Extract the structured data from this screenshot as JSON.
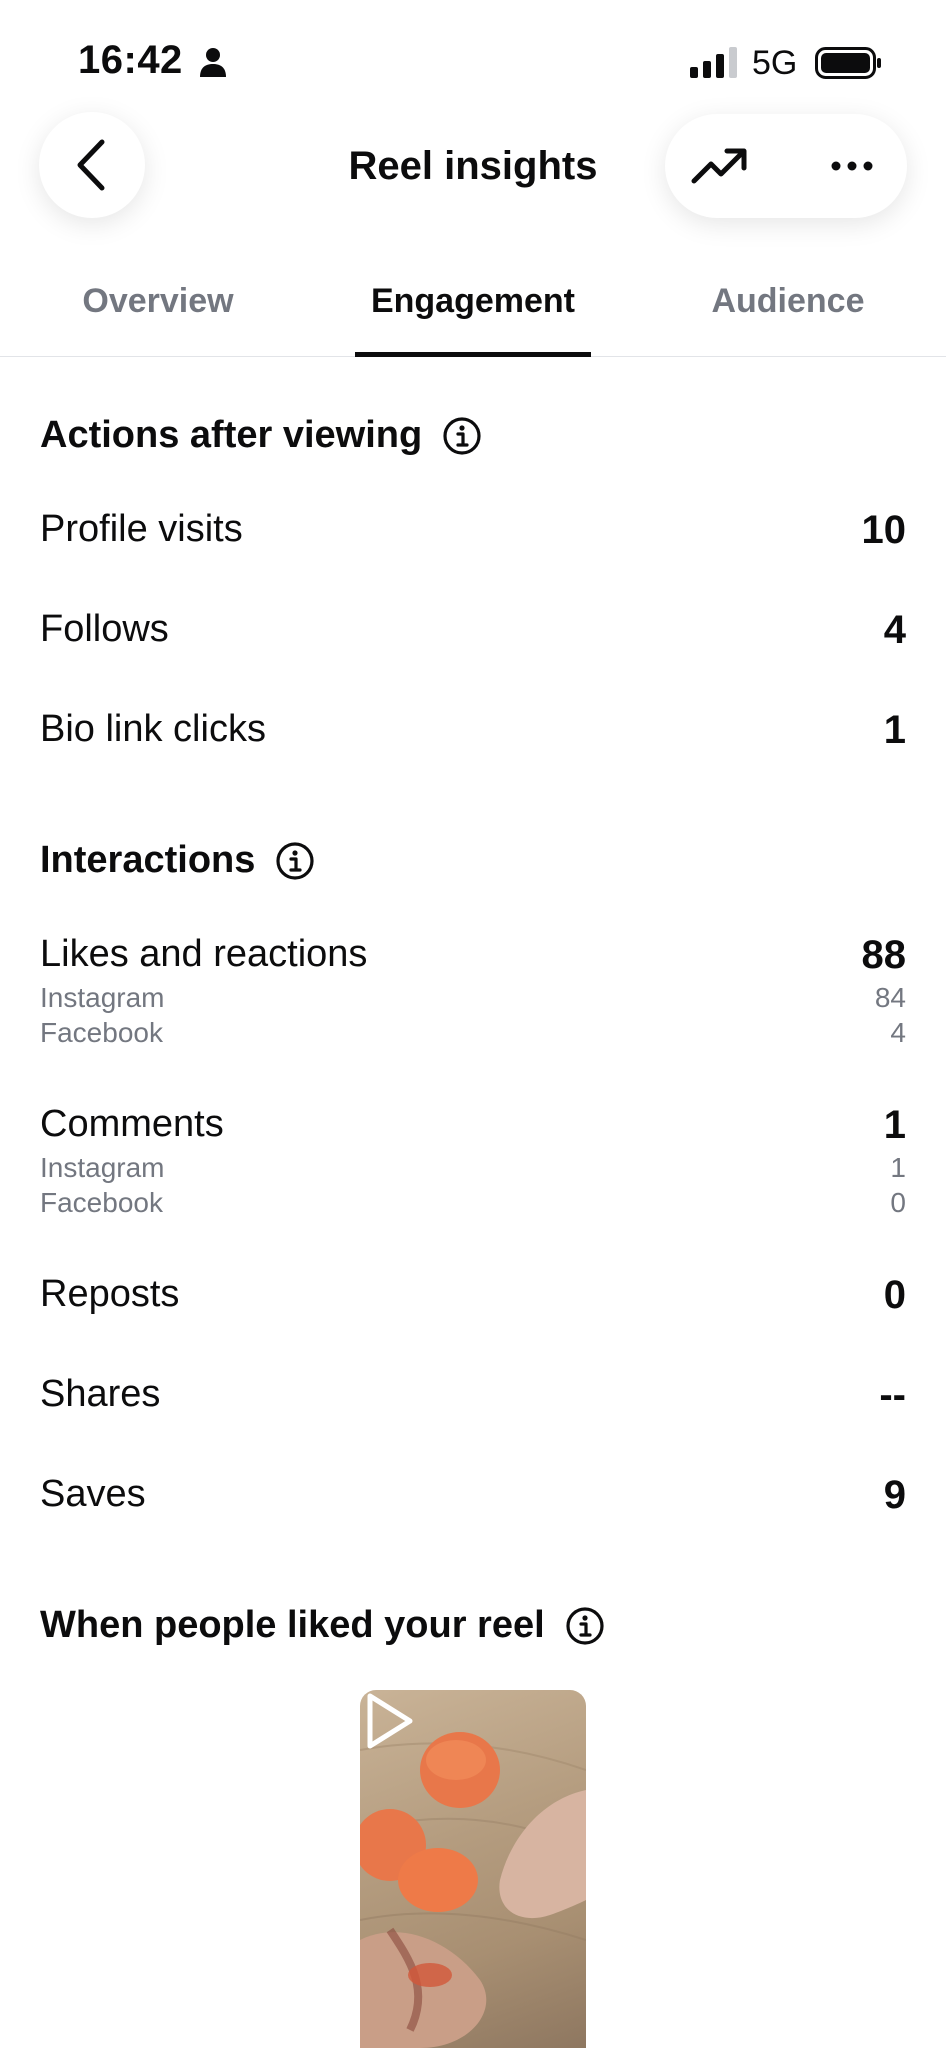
{
  "status_bar": {
    "time": "16:42",
    "network": "5G",
    "icons": [
      "person-icon",
      "signal-icon",
      "battery-icon"
    ]
  },
  "header": {
    "title": "Reel insights",
    "back_icon": "chevron-left-icon",
    "trend_icon": "trending-up-icon",
    "more_icon": "more-horizontal-icon"
  },
  "tabs": [
    {
      "label": "Overview",
      "active": false
    },
    {
      "label": "Engagement",
      "active": true
    },
    {
      "label": "Audience",
      "active": false
    }
  ],
  "actions_after_viewing": {
    "title": "Actions after viewing",
    "rows": [
      {
        "label": "Profile visits",
        "value": "10"
      },
      {
        "label": "Follows",
        "value": "4"
      },
      {
        "label": "Bio link clicks",
        "value": "1"
      }
    ]
  },
  "interactions": {
    "title": "Interactions",
    "likes": {
      "label": "Likes and reactions",
      "value": "88",
      "breakdown": [
        {
          "label": "Instagram",
          "value": "84"
        },
        {
          "label": "Facebook",
          "value": "4"
        }
      ]
    },
    "comments": {
      "label": "Comments",
      "value": "1",
      "breakdown": [
        {
          "label": "Instagram",
          "value": "1"
        },
        {
          "label": "Facebook",
          "value": "0"
        }
      ]
    },
    "rows": [
      {
        "label": "Reposts",
        "value": "0"
      },
      {
        "label": "Shares",
        "value": "--"
      },
      {
        "label": "Saves",
        "value": "9"
      }
    ]
  },
  "when_liked": {
    "title": "When people liked your reel",
    "thumbnail_icon": "play-icon"
  },
  "colors": {
    "text": "#0c0c0d",
    "muted": "#737780",
    "divider": "#e2e4e8"
  }
}
